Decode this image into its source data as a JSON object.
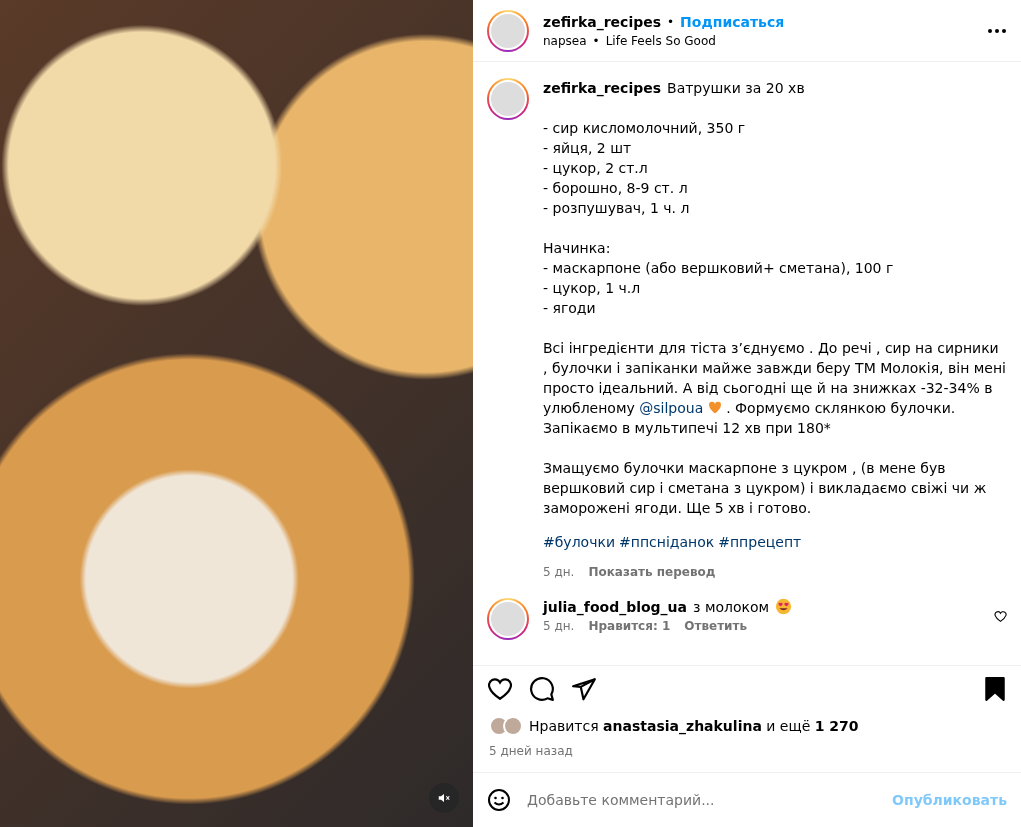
{
  "post": {
    "muted": true
  },
  "header": {
    "username": "zefirka_recipes",
    "separator": "•",
    "follow": "Подписаться",
    "audio": "napsea",
    "audio_separator": "•",
    "song": "Life Feels So Good"
  },
  "caption": {
    "username": "zefirka_recipes",
    "title": "Ватрушки за 20 хв",
    "paragraphs": [
      {
        "lines": [
          "- сир кисломолочний, 350 г",
          "- яйця, 2 шт",
          "- цукор, 2 ст.л",
          "- борошно, 8-9 ст. л",
          "- розпушувач, 1 ч. л"
        ]
      },
      {
        "lines": [
          "Начинка:",
          "- маскарпоне (або вершковий+ сметана), 100 г",
          "- цукор, 1 ч.л",
          "- ягоди"
        ]
      },
      {
        "before": "Всі інгредієнти для тіста з’єднуємо . До речі , сир на сирники , булочки і запіканки майже завжди беру ТМ Молокія, він мені просто ідеальний. А від сьогодні ще й на знижках -32-34% в улюбленому",
        "mention": "@silpoua",
        "after": ". Формуємо склянкою булочки. Запікаємо в мультипечі 12 хв при 180*"
      },
      {
        "lines": [
          "Змащуємо булочки маскарпоне з цукром , (в мене був вершковий сир і сметана з цукром) і викладаємо свіжі чи ж заморожені ягоди. Ще 5 хв і готово."
        ]
      }
    ],
    "hashtags": [
      "#булочки",
      "#ппсніданок",
      "#ппрецепт"
    ],
    "time": "5 дн.",
    "translate": "Показать перевод"
  },
  "comments": [
    {
      "username": "julia_food_blog_ua",
      "text": "з молоком",
      "time": "5 дн.",
      "likes": "Нравится: 1",
      "reply": "Ответить",
      "liked": false
    }
  ],
  "actions": {
    "saved": true
  },
  "likes": {
    "prefix": "Нравится",
    "user": "anastasia_zhakulina",
    "middle": "и ещё",
    "count": "1 270"
  },
  "date": "5 дней назад",
  "composer": {
    "placeholder": "Добавьте комментарий...",
    "submit": "Опубликовать"
  }
}
